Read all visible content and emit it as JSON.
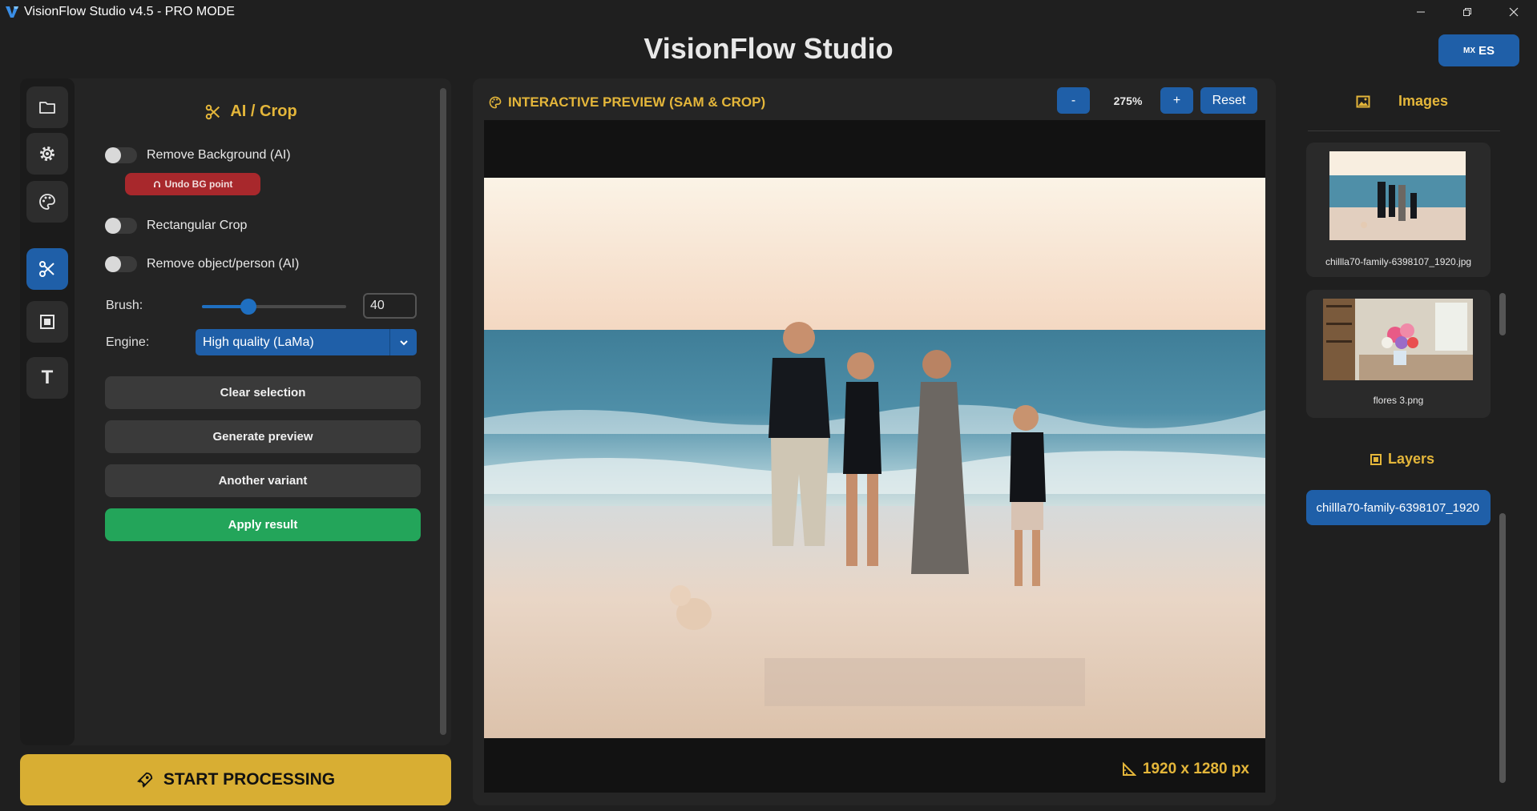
{
  "window": {
    "title": "VisionFlow Studio v4.5 - PRO MODE"
  },
  "header": {
    "title": "VisionFlow Studio",
    "language": {
      "flag_text": "MX",
      "code": "ES"
    }
  },
  "sidebar": {
    "active_index": 3,
    "items": [
      {
        "icon": "folder-icon"
      },
      {
        "icon": "gear-icon"
      },
      {
        "icon": "palette-icon"
      },
      {
        "icon": "scissors-icon"
      },
      {
        "icon": "frame-icon"
      },
      {
        "icon": "text-icon",
        "glyph": "T"
      }
    ]
  },
  "tools": {
    "title": "AI / Crop",
    "remove_background": {
      "label": "Remove Background (AI)",
      "enabled": false
    },
    "undo_bg_point": "Undo BG point",
    "rectangular_crop": {
      "label": "Rectangular Crop",
      "enabled": false
    },
    "remove_object": {
      "label": "Remove object/person (AI)",
      "enabled": false
    },
    "brush": {
      "label": "Brush:",
      "value": "40",
      "slider_fraction": 0.32
    },
    "engine": {
      "label": "Engine:",
      "selected": "High quality (LaMa)"
    },
    "buttons": {
      "clear_selection": "Clear selection",
      "generate_preview": "Generate preview",
      "another_variant": "Another variant",
      "apply_result": "Apply result"
    }
  },
  "start_processing": "START PROCESSING",
  "preview": {
    "title": "INTERACTIVE PREVIEW (SAM & CROP)",
    "zoom_out": "-",
    "zoom_level": "275%",
    "zoom_in": "+",
    "reset": "Reset",
    "dimensions": "1920 x 1280 px"
  },
  "images": {
    "title": "Images",
    "items": [
      {
        "name": "chillla70-family-6398107_1920.jpg"
      },
      {
        "name": "flores 3.png"
      }
    ]
  },
  "layers": {
    "title": "Layers",
    "items": [
      {
        "name": "chillla70-family-6398107_1920"
      }
    ]
  },
  "colors": {
    "accent_gold": "#e4b63a",
    "primary_blue": "#1f5fa8",
    "danger_red": "#a8282c",
    "success_green": "#23a55a"
  }
}
